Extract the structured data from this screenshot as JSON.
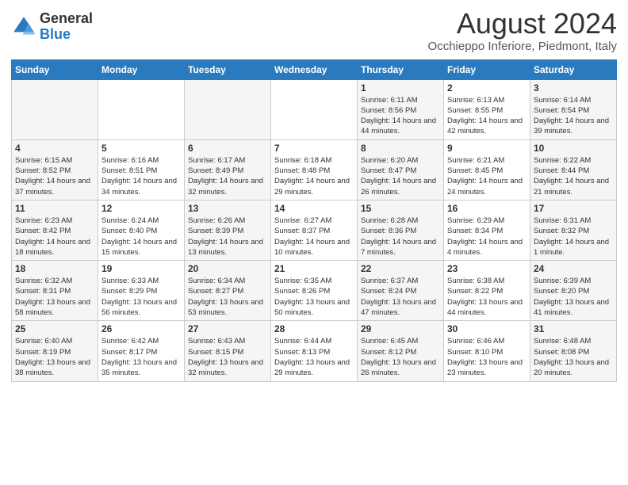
{
  "header": {
    "logo": {
      "general": "General",
      "blue": "Blue"
    },
    "title": "August 2024",
    "location": "Occhieppo Inferiore, Piedmont, Italy"
  },
  "calendar": {
    "headers": [
      "Sunday",
      "Monday",
      "Tuesday",
      "Wednesday",
      "Thursday",
      "Friday",
      "Saturday"
    ],
    "weeks": [
      [
        {
          "day": "",
          "info": ""
        },
        {
          "day": "",
          "info": ""
        },
        {
          "day": "",
          "info": ""
        },
        {
          "day": "",
          "info": ""
        },
        {
          "day": "1",
          "info": "Sunrise: 6:11 AM\nSunset: 8:56 PM\nDaylight: 14 hours and 44 minutes."
        },
        {
          "day": "2",
          "info": "Sunrise: 6:13 AM\nSunset: 8:55 PM\nDaylight: 14 hours and 42 minutes."
        },
        {
          "day": "3",
          "info": "Sunrise: 6:14 AM\nSunset: 8:54 PM\nDaylight: 14 hours and 39 minutes."
        }
      ],
      [
        {
          "day": "4",
          "info": "Sunrise: 6:15 AM\nSunset: 8:52 PM\nDaylight: 14 hours and 37 minutes."
        },
        {
          "day": "5",
          "info": "Sunrise: 6:16 AM\nSunset: 8:51 PM\nDaylight: 14 hours and 34 minutes."
        },
        {
          "day": "6",
          "info": "Sunrise: 6:17 AM\nSunset: 8:49 PM\nDaylight: 14 hours and 32 minutes."
        },
        {
          "day": "7",
          "info": "Sunrise: 6:18 AM\nSunset: 8:48 PM\nDaylight: 14 hours and 29 minutes."
        },
        {
          "day": "8",
          "info": "Sunrise: 6:20 AM\nSunset: 8:47 PM\nDaylight: 14 hours and 26 minutes."
        },
        {
          "day": "9",
          "info": "Sunrise: 6:21 AM\nSunset: 8:45 PM\nDaylight: 14 hours and 24 minutes."
        },
        {
          "day": "10",
          "info": "Sunrise: 6:22 AM\nSunset: 8:44 PM\nDaylight: 14 hours and 21 minutes."
        }
      ],
      [
        {
          "day": "11",
          "info": "Sunrise: 6:23 AM\nSunset: 8:42 PM\nDaylight: 14 hours and 18 minutes."
        },
        {
          "day": "12",
          "info": "Sunrise: 6:24 AM\nSunset: 8:40 PM\nDaylight: 14 hours and 15 minutes."
        },
        {
          "day": "13",
          "info": "Sunrise: 6:26 AM\nSunset: 8:39 PM\nDaylight: 14 hours and 13 minutes."
        },
        {
          "day": "14",
          "info": "Sunrise: 6:27 AM\nSunset: 8:37 PM\nDaylight: 14 hours and 10 minutes."
        },
        {
          "day": "15",
          "info": "Sunrise: 6:28 AM\nSunset: 8:36 PM\nDaylight: 14 hours and 7 minutes."
        },
        {
          "day": "16",
          "info": "Sunrise: 6:29 AM\nSunset: 8:34 PM\nDaylight: 14 hours and 4 minutes."
        },
        {
          "day": "17",
          "info": "Sunrise: 6:31 AM\nSunset: 8:32 PM\nDaylight: 14 hours and 1 minute."
        }
      ],
      [
        {
          "day": "18",
          "info": "Sunrise: 6:32 AM\nSunset: 8:31 PM\nDaylight: 13 hours and 58 minutes."
        },
        {
          "day": "19",
          "info": "Sunrise: 6:33 AM\nSunset: 8:29 PM\nDaylight: 13 hours and 56 minutes."
        },
        {
          "day": "20",
          "info": "Sunrise: 6:34 AM\nSunset: 8:27 PM\nDaylight: 13 hours and 53 minutes."
        },
        {
          "day": "21",
          "info": "Sunrise: 6:35 AM\nSunset: 8:26 PM\nDaylight: 13 hours and 50 minutes."
        },
        {
          "day": "22",
          "info": "Sunrise: 6:37 AM\nSunset: 8:24 PM\nDaylight: 13 hours and 47 minutes."
        },
        {
          "day": "23",
          "info": "Sunrise: 6:38 AM\nSunset: 8:22 PM\nDaylight: 13 hours and 44 minutes."
        },
        {
          "day": "24",
          "info": "Sunrise: 6:39 AM\nSunset: 8:20 PM\nDaylight: 13 hours and 41 minutes."
        }
      ],
      [
        {
          "day": "25",
          "info": "Sunrise: 6:40 AM\nSunset: 8:19 PM\nDaylight: 13 hours and 38 minutes."
        },
        {
          "day": "26",
          "info": "Sunrise: 6:42 AM\nSunset: 8:17 PM\nDaylight: 13 hours and 35 minutes."
        },
        {
          "day": "27",
          "info": "Sunrise: 6:43 AM\nSunset: 8:15 PM\nDaylight: 13 hours and 32 minutes."
        },
        {
          "day": "28",
          "info": "Sunrise: 6:44 AM\nSunset: 8:13 PM\nDaylight: 13 hours and 29 minutes."
        },
        {
          "day": "29",
          "info": "Sunrise: 6:45 AM\nSunset: 8:12 PM\nDaylight: 13 hours and 26 minutes."
        },
        {
          "day": "30",
          "info": "Sunrise: 6:46 AM\nSunset: 8:10 PM\nDaylight: 13 hours and 23 minutes."
        },
        {
          "day": "31",
          "info": "Sunrise: 6:48 AM\nSunset: 8:08 PM\nDaylight: 13 hours and 20 minutes."
        }
      ]
    ]
  }
}
